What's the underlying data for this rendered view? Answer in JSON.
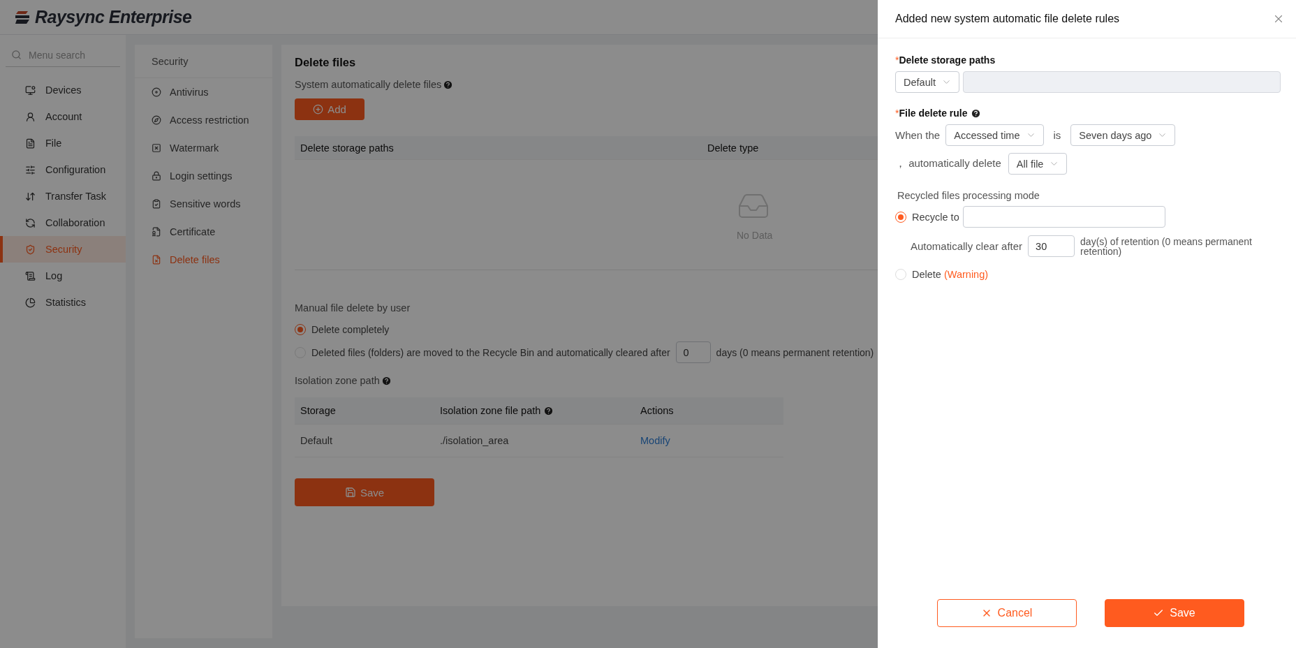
{
  "brand": {
    "name": "Raysync Enterprise"
  },
  "sidebar": {
    "search": {
      "placeholder": "Menu search"
    },
    "items": [
      {
        "label": "Devices",
        "selected": false
      },
      {
        "label": "Account",
        "selected": false
      },
      {
        "label": "File",
        "selected": false
      },
      {
        "label": "Configuration",
        "selected": false
      },
      {
        "label": "Transfer Task",
        "selected": false
      },
      {
        "label": "Collaboration",
        "selected": false
      },
      {
        "label": "Security",
        "selected": true
      },
      {
        "label": "Log",
        "selected": false
      },
      {
        "label": "Statistics",
        "selected": false
      }
    ]
  },
  "submenu": {
    "title": "Security",
    "items": [
      {
        "label": "Antivirus",
        "selected": false
      },
      {
        "label": "Access restriction",
        "selected": false
      },
      {
        "label": "Watermark",
        "selected": false
      },
      {
        "label": "Login settings",
        "selected": false
      },
      {
        "label": "Sensitive words",
        "selected": false
      },
      {
        "label": "Certificate",
        "selected": false
      },
      {
        "label": "Delete files",
        "selected": true
      }
    ]
  },
  "page": {
    "title": "Delete files",
    "auto_delete": {
      "label": "System automatically delete files",
      "help": true,
      "add_button": "Add",
      "columns": [
        "Delete storage paths",
        "Delete type"
      ],
      "empty_text": "No Data"
    },
    "manual_delete": {
      "label": "Manual file delete by user",
      "options": [
        {
          "kind": "plain",
          "label": "Delete completely",
          "selected": true
        },
        {
          "kind": "days",
          "label": "Deleted files (folders) are moved to the Recycle Bin and automatically cleared after",
          "value": "0",
          "suffix": "days (0 means permanent retention)",
          "selected": false
        }
      ]
    },
    "isolation": {
      "label": "Isolation zone path",
      "help": true,
      "columns": [
        {
          "label": "Storage",
          "help": false
        },
        {
          "label": "Isolation zone file path",
          "help": true
        },
        {
          "label": "Actions",
          "help": false
        }
      ],
      "rows": [
        {
          "storage": "Default",
          "path": "./isolation_area",
          "action": "Modify"
        }
      ]
    },
    "save_button": "Save"
  },
  "drawer": {
    "title": "Added new system automatic file delete rules",
    "storage": {
      "required_mark": "*",
      "label": "Delete storage paths",
      "select": "Default"
    },
    "rule": {
      "required_mark": "*",
      "label": "File delete rule",
      "help": true,
      "prefix": "When the",
      "field": "Accessed time",
      "verb": "is",
      "time": "Seven days ago",
      "lead": "， automatically delete",
      "target": "All file"
    },
    "recycle": {
      "label": "Recycled files processing mode",
      "options": [
        {
          "kind": "recycle",
          "label": "Recycle to",
          "selected": true,
          "clear_label": "Automatically clear after",
          "days": "30",
          "days_suffix": "day(s) of retention (0 means permanent retention)"
        },
        {
          "kind": "delete",
          "label": "Delete",
          "warning": "(Warning)",
          "selected": false
        }
      ]
    },
    "cancel_button": "Cancel",
    "save_button": "Save"
  }
}
